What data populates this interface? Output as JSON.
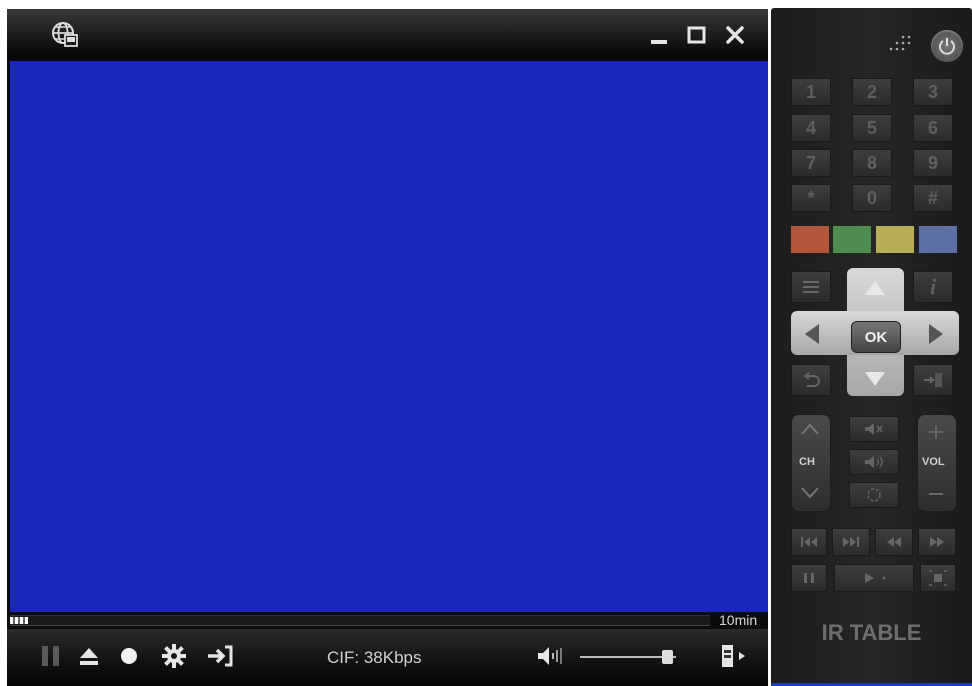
{
  "player": {
    "video_color": "#1b27b8",
    "seek": {
      "progress_fraction": 0.025,
      "label": "10min"
    },
    "status_text": "CIF: 38Kbps",
    "volume_fraction": 0.97,
    "icons": {
      "app": "globe-window-icon",
      "minimize": "minimize-icon",
      "maximize": "maximize-icon",
      "close": "close-icon",
      "pause": "pause-icon",
      "eject": "eject-icon",
      "record": "record-icon",
      "settings": "gear-icon",
      "exit": "exit-icon",
      "volume": "speaker-icon",
      "remote_toggle": "remote-icon"
    }
  },
  "remote": {
    "numpad": [
      "1",
      "2",
      "3",
      "4",
      "5",
      "6",
      "7",
      "8",
      "9",
      "*",
      "0",
      "#"
    ],
    "color_buttons": [
      "#b3573c",
      "#4f8c50",
      "#b9ae58",
      "#5c70a3"
    ],
    "ok_label": "OK",
    "ch_label": "CH",
    "vol_label": "VOL",
    "footer_label": "IR TABLE"
  }
}
